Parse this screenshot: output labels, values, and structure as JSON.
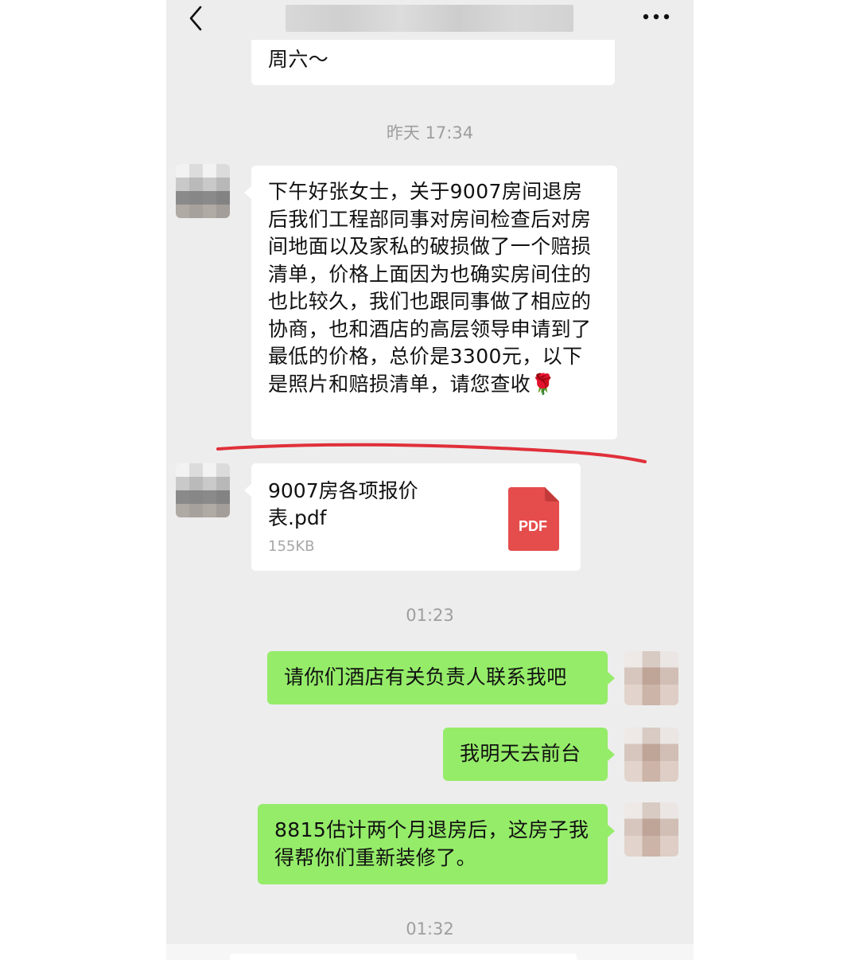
{
  "header": {
    "back_icon": "chevron-left-icon",
    "title": "",
    "more_icon": "more-dots-icon"
  },
  "messages": {
    "prev_fragment": "周六～",
    "time_1": "昨天 17:34",
    "incoming_text": "下午好张女士，关于9007房间退房后我们工程部同事对房间检查后对房间地面以及家私的破损做了一个赔损清单，价格上面因为也确实房间住的也比较久，我们也跟同事做了相应的协商，也和酒店的高层领导申请到了最低的价格，总价是3300元，以下是照片和赔损清单，请您查收🌹",
    "file": {
      "name": "9007房各项报价表.pdf",
      "size": "155KB",
      "icon_label": "PDF",
      "icon_color": "#e54d4d"
    },
    "time_2": "01:23",
    "out_1": "请你们酒店有关负责人联系我吧",
    "out_2": "我明天去前台",
    "out_3": "8815估计两个月退房后，这房子我得帮你们重新装修了。",
    "time_3": "01:32"
  },
  "colors": {
    "chat_bg": "#ededed",
    "incoming_bubble": "#ffffff",
    "outgoing_bubble": "#95ec69",
    "annotation_line": "#e0303a"
  }
}
